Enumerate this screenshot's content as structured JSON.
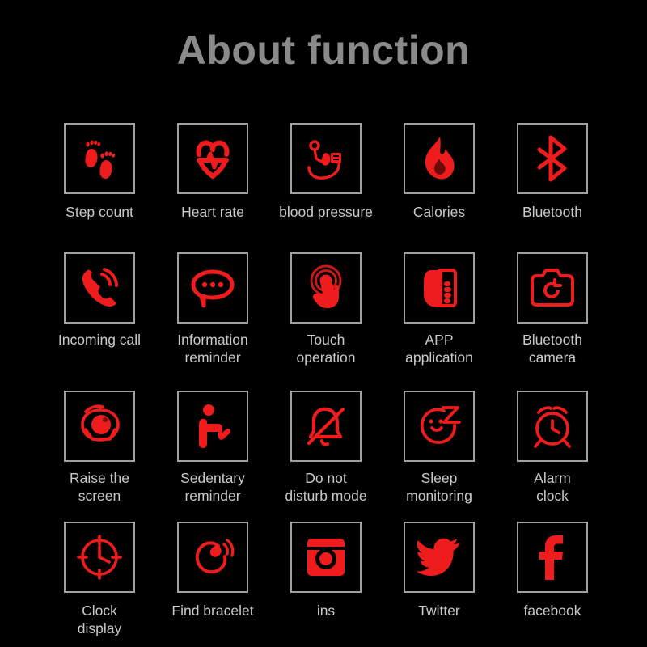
{
  "header": {
    "title": "About function"
  },
  "colors": {
    "background": "#000000",
    "icon_red": "#ee1c1c",
    "box_border": "#a0a0a0",
    "title_gray": "#8a8a8a",
    "label_gray": "#c9c9c9"
  },
  "grid": {
    "columns": 5,
    "rows": 4,
    "items": [
      {
        "label": "Step count",
        "icon": "footprints-icon"
      },
      {
        "label": "Heart rate",
        "icon": "heart-pulse-icon"
      },
      {
        "label": "blood pressure",
        "icon": "blood-pressure-icon"
      },
      {
        "label": "Calories",
        "icon": "flame-icon"
      },
      {
        "label": "Bluetooth",
        "icon": "bluetooth-icon"
      },
      {
        "label": "Incoming call",
        "icon": "phone-ringing-icon"
      },
      {
        "label": "Information\nreminder",
        "icon": "speech-bubble-dots-icon"
      },
      {
        "label": "Touch\noperation",
        "icon": "touch-tap-icon"
      },
      {
        "label": "APP\napplication",
        "icon": "hand-phone-icon"
      },
      {
        "label": "Bluetooth\ncamera",
        "icon": "camera-icon"
      },
      {
        "label": "Raise the\nscreen",
        "icon": "raise-to-wake-eye-icon"
      },
      {
        "label": "Sedentary\nreminder",
        "icon": "seated-person-icon"
      },
      {
        "label": "Do not\ndisturb mode",
        "icon": "bell-slash-icon"
      },
      {
        "label": "Sleep\nmonitoring",
        "icon": "sleep-face-z-icon"
      },
      {
        "label": "Alarm\nclock",
        "icon": "alarm-clock-icon"
      },
      {
        "label": "Clock\ndisplay",
        "icon": "clock-face-icon"
      },
      {
        "label": "Find bracelet",
        "icon": "bracelet-signal-icon"
      },
      {
        "label": "ins",
        "icon": "instagram-icon"
      },
      {
        "label": "Twitter",
        "icon": "twitter-bird-icon"
      },
      {
        "label": "facebook",
        "icon": "facebook-f-icon"
      }
    ]
  }
}
